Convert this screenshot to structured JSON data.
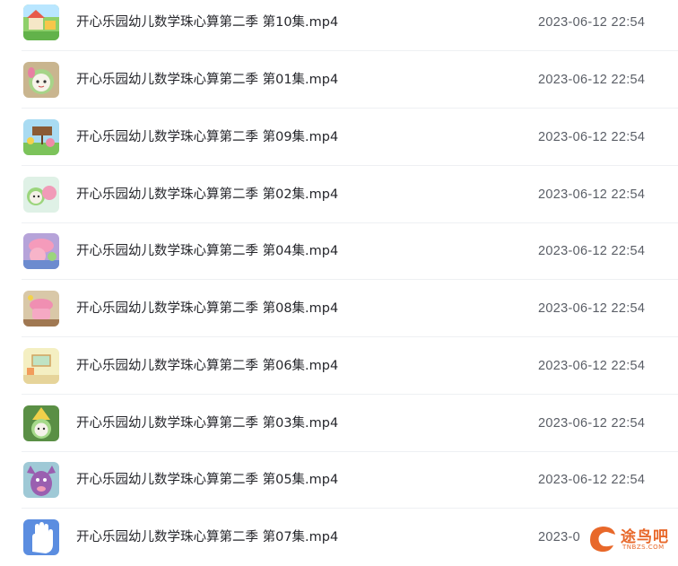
{
  "files": [
    {
      "name": "开心乐园幼儿数学珠心算第二季 第10集.mp4",
      "date": "2023-06-12 22:54",
      "thumb": "thumb-scene-house"
    },
    {
      "name": "开心乐园幼儿数学珠心算第二季 第01集.mp4",
      "date": "2023-06-12 22:54",
      "thumb": "thumb-character-green"
    },
    {
      "name": "开心乐园幼儿数学珠心算第二季 第09集.mp4",
      "date": "2023-06-12 22:54",
      "thumb": "thumb-scene-sign"
    },
    {
      "name": "开心乐园幼儿数学珠心算第二季 第02集.mp4",
      "date": "2023-06-12 22:54",
      "thumb": "thumb-character-pink"
    },
    {
      "name": "开心乐园幼儿数学珠心算第二季 第04集.mp4",
      "date": "2023-06-12 22:54",
      "thumb": "thumb-character-pink-hat"
    },
    {
      "name": "开心乐园幼儿数学珠心算第二季 第08集.mp4",
      "date": "2023-06-12 22:54",
      "thumb": "thumb-character-pink-room"
    },
    {
      "name": "开心乐园幼儿数学珠心算第二季 第06集.mp4",
      "date": "2023-06-12 22:54",
      "thumb": "thumb-scene-room"
    },
    {
      "name": "开心乐园幼儿数学珠心算第二季 第03集.mp4",
      "date": "2023-06-12 22:54",
      "thumb": "thumb-character-forest"
    },
    {
      "name": "开心乐园幼儿数学珠心算第二季 第05集.mp4",
      "date": "2023-06-12 22:54",
      "thumb": "thumb-character-purple"
    },
    {
      "name": "开心乐园幼儿数学珠心算第二季 第07集.mp4",
      "date": "2023-0",
      "thumb": "thumb-hand-blue"
    }
  ],
  "watermark": {
    "text": "途鸟吧",
    "sub": "TNBZS.COM"
  },
  "colors": {
    "name_text": "#25262b",
    "date_text": "#5a5e66",
    "divider": "#eef0f3",
    "watermark": "#e8682a"
  }
}
